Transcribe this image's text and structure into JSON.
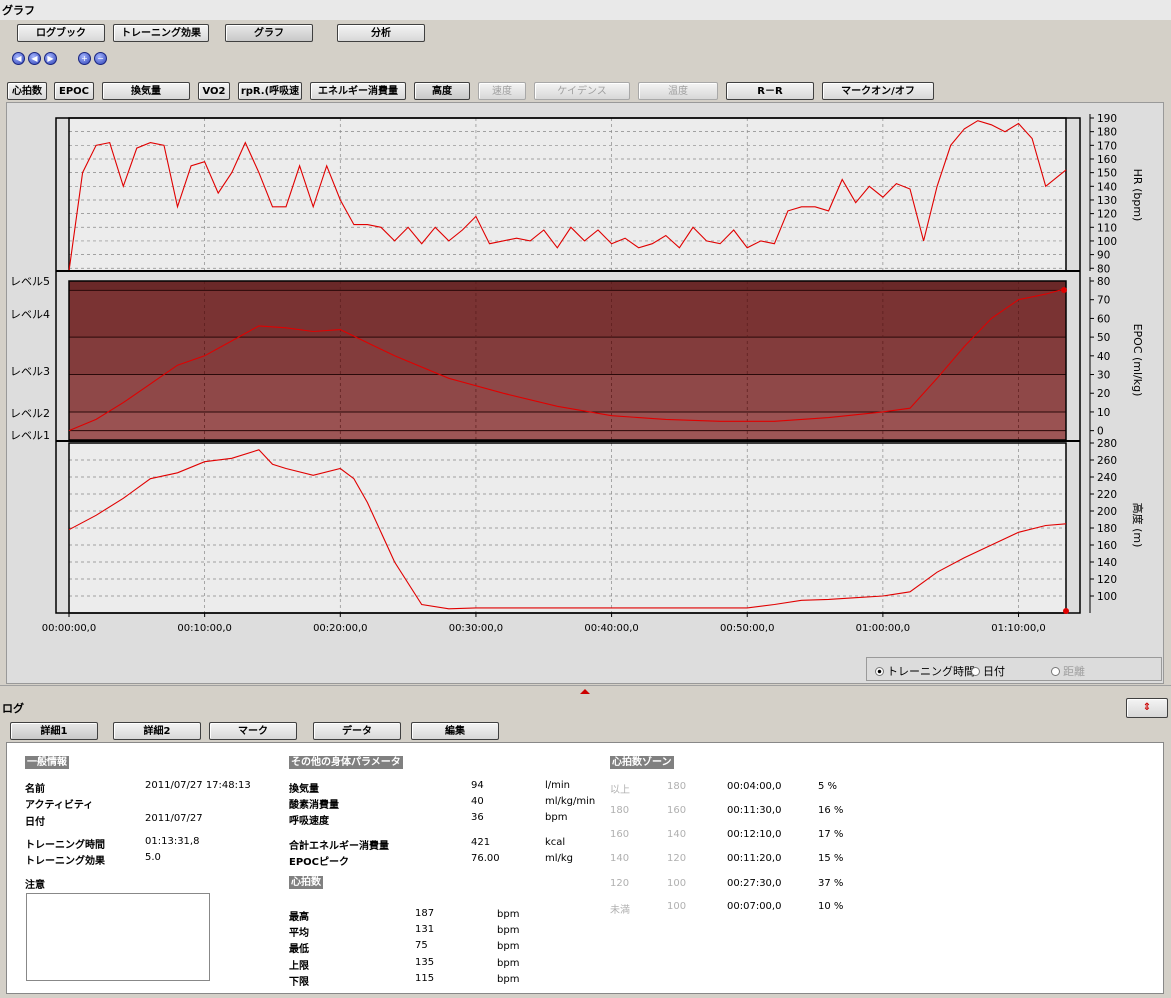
{
  "window": {
    "title": "グラフ"
  },
  "tabs": [
    {
      "label": "ログブック"
    },
    {
      "label": "トレーニング効果"
    },
    {
      "label": "グラフ"
    },
    {
      "label": "分析"
    }
  ],
  "nav_icons": [
    "first-icon",
    "prev-icon",
    "next-icon",
    "zoom-in-icon",
    "zoom-out-icon"
  ],
  "metric_buttons": [
    {
      "label": "心拍数",
      "enabled": true
    },
    {
      "label": "EPOC",
      "enabled": true
    },
    {
      "label": "換気量",
      "enabled": true
    },
    {
      "label": "VO2",
      "enabled": true
    },
    {
      "label": "rpR.(呼吸速",
      "enabled": true
    },
    {
      "label": "エネルギー消費量",
      "enabled": true
    },
    {
      "label": "高度",
      "enabled": true
    },
    {
      "label": "速度",
      "enabled": false
    },
    {
      "label": "ケイデンス",
      "enabled": false
    },
    {
      "label": "温度",
      "enabled": false
    },
    {
      "label": "R－R",
      "enabled": true
    },
    {
      "label": "マークオン/オフ",
      "enabled": true
    }
  ],
  "chart_data": [
    {
      "type": "line",
      "ylabel": "HR (bpm)",
      "ylim": [
        78,
        190
      ],
      "yticks": [
        80,
        90,
        100,
        110,
        120,
        130,
        140,
        150,
        160,
        170,
        180,
        190
      ],
      "x_minutes": [
        0,
        1,
        2,
        3,
        4,
        5,
        6,
        7,
        8,
        9,
        10,
        11,
        12,
        13,
        14,
        15,
        16,
        17,
        18,
        19,
        20,
        21,
        22,
        23,
        24,
        25,
        26,
        27,
        28,
        29,
        30,
        31,
        32,
        33,
        34,
        35,
        36,
        37,
        38,
        39,
        40,
        41,
        42,
        43,
        44,
        45,
        46,
        47,
        48,
        49,
        50,
        51,
        52,
        53,
        54,
        55,
        56,
        57,
        58,
        59,
        60,
        61,
        62,
        63,
        64,
        65,
        66,
        67,
        68,
        69,
        70,
        71,
        72,
        73.5
      ],
      "values": [
        78,
        150,
        170,
        172,
        140,
        168,
        172,
        170,
        125,
        155,
        158,
        135,
        150,
        172,
        150,
        125,
        125,
        155,
        125,
        155,
        130,
        112,
        112,
        110,
        100,
        110,
        98,
        110,
        100,
        108,
        118,
        98,
        100,
        102,
        100,
        108,
        95,
        110,
        100,
        108,
        98,
        102,
        95,
        98,
        104,
        95,
        110,
        100,
        98,
        108,
        95,
        100,
        98,
        122,
        125,
        125,
        122,
        145,
        128,
        140,
        132,
        142,
        138,
        100,
        140,
        170,
        182,
        188,
        185,
        180,
        186,
        175,
        140,
        152,
        150
      ],
      "line_color": "#e00000"
    },
    {
      "type": "line",
      "ylabel": "EPOC (ml/kg)",
      "ylim": [
        -5,
        80
      ],
      "yticks": [
        0,
        10,
        20,
        30,
        40,
        50,
        60,
        70,
        80
      ],
      "levels": [
        "レベル5",
        "レベル4",
        "レベル3",
        "レベル2",
        "レベル1"
      ],
      "x_minutes": [
        0,
        2,
        4,
        6,
        8,
        10,
        12,
        14,
        16,
        18,
        20,
        24,
        28,
        32,
        36,
        40,
        44,
        48,
        52,
        56,
        60,
        62,
        64,
        66,
        68,
        70,
        72,
        73.5
      ],
      "values": [
        0,
        6,
        15,
        25,
        35,
        40,
        48,
        56,
        55,
        53,
        54,
        40,
        28,
        20,
        13,
        8,
        6,
        5,
        5,
        7,
        10,
        12,
        28,
        45,
        60,
        70,
        73,
        76
      ],
      "line_color": "#e00000"
    },
    {
      "type": "line",
      "ylabel": "高度 (m)",
      "ylim": [
        80,
        280
      ],
      "yticks": [
        100,
        120,
        140,
        160,
        180,
        200,
        220,
        240,
        260,
        280
      ],
      "x_minutes": [
        0,
        2,
        4,
        6,
        8,
        10,
        12,
        14,
        15,
        16,
        18,
        20,
        21,
        22,
        24,
        26,
        28,
        30,
        35,
        40,
        45,
        50,
        52,
        54,
        56,
        58,
        60,
        62,
        64,
        66,
        68,
        70,
        72,
        73.5
      ],
      "values": [
        178,
        195,
        215,
        238,
        245,
        258,
        262,
        272,
        255,
        250,
        242,
        250,
        238,
        210,
        140,
        90,
        85,
        86,
        86,
        86,
        86,
        86,
        90,
        95,
        96,
        98,
        100,
        105,
        128,
        145,
        160,
        175,
        183,
        185
      ],
      "line_color": "#e00000"
    }
  ],
  "x_axis": {
    "tick_labels": [
      "00:00:00,0",
      "00:10:00,0",
      "00:20:00,0",
      "00:30:00,0",
      "00:40:00,0",
      "00:50:00,0",
      "01:00:00,0",
      "01:10:00,0"
    ]
  },
  "radio": {
    "options": [
      {
        "label": "トレーニング時間",
        "checked": true,
        "enabled": true
      },
      {
        "label": "日付",
        "checked": false,
        "enabled": true
      },
      {
        "label": "距離",
        "checked": false,
        "enabled": false
      }
    ]
  },
  "log": {
    "title": "ログ",
    "sort_icon": "up-down-arrows-icon",
    "tabs": [
      {
        "label": "詳細1"
      },
      {
        "label": "詳細2"
      },
      {
        "label": "マーク"
      },
      {
        "label": "データ"
      },
      {
        "label": "編集"
      }
    ],
    "general": {
      "header": "一般情報",
      "rows": [
        {
          "label": "名前",
          "value": "2011/07/27 17:48:13"
        },
        {
          "label": "アクティビティ",
          "value": ""
        },
        {
          "label": "日付",
          "value": "2011/07/27"
        },
        {
          "label": "トレーニング時間",
          "value": "01:13:31,8"
        },
        {
          "label": "トレーニング効果",
          "value": "5.0"
        }
      ],
      "note_label": "注意"
    },
    "body_params": {
      "header": "その他の身体パラメータ",
      "rows": [
        {
          "label": "換気量",
          "value": "94",
          "unit": "l/min"
        },
        {
          "label": "酸素消費量",
          "value": "40",
          "unit": "ml/kg/min"
        },
        {
          "label": "呼吸速度",
          "value": "36",
          "unit": "bpm"
        },
        {
          "label": "合計エネルギー消費量",
          "value": "421",
          "unit": "kcal"
        },
        {
          "label": "EPOCピーク",
          "value": "76.00",
          "unit": "ml/kg"
        }
      ]
    },
    "heart_rate": {
      "header": "心拍数",
      "rows": [
        {
          "label": "最高",
          "value": "187",
          "unit": "bpm"
        },
        {
          "label": "平均",
          "value": "131",
          "unit": "bpm"
        },
        {
          "label": "最低",
          "value": "75",
          "unit": "bpm"
        },
        {
          "label": "上限",
          "value": "135",
          "unit": "bpm"
        },
        {
          "label": "下限",
          "value": "115",
          "unit": "bpm"
        }
      ]
    },
    "hr_zones": {
      "header": "心拍数ゾーン",
      "rows": [
        {
          "a": "以上",
          "b": "180",
          "time": "00:04:00,0",
          "pct": "5 %"
        },
        {
          "a": "180",
          "b": "160",
          "time": "00:11:30,0",
          "pct": "16 %"
        },
        {
          "a": "160",
          "b": "140",
          "time": "00:12:10,0",
          "pct": "17 %"
        },
        {
          "a": "140",
          "b": "120",
          "time": "00:11:20,0",
          "pct": "15 %"
        },
        {
          "a": "120",
          "b": "100",
          "time": "00:27:30,0",
          "pct": "37 %"
        },
        {
          "a": "未満",
          "b": "100",
          "time": "00:07:00,0",
          "pct": "10 %"
        }
      ]
    }
  }
}
